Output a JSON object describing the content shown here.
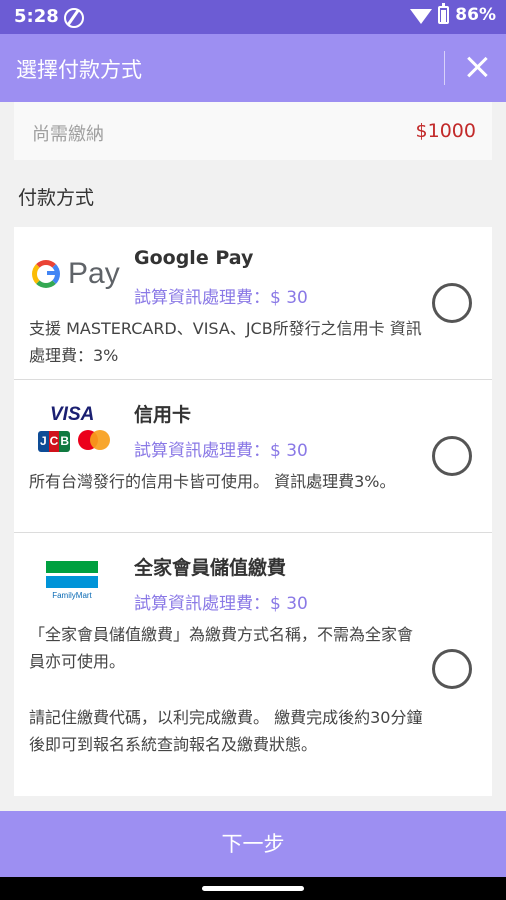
{
  "status_bar": {
    "time": "5:28",
    "battery": "86%"
  },
  "header": {
    "title": "選擇付款方式"
  },
  "amount_due": {
    "label": "尚需繳納",
    "value": "$1000"
  },
  "payment_section": {
    "title": "付款方式",
    "methods": [
      {
        "name": "Google Pay",
        "fee": "試算資訊處理費：$ 30",
        "description": "支援 MASTERCARD、VISA、JCB所發行之信用卡 資訊處理費：3%",
        "logo_text": "Pay"
      },
      {
        "name": "信用卡",
        "fee": "試算資訊處理費：$ 30",
        "description": "所有台灣發行的信用卡皆可使用。 資訊處理費3%。",
        "logo_text": "VISA"
      },
      {
        "name": "全家會員儲值繳費",
        "fee": "試算資訊處理費：$ 30",
        "description": "「全家會員儲值繳費」為繳費方式名稱，不需為全家會員亦可使用。",
        "note": "請記住繳費代碼，以利完成繳費。 繳費完成後約30分鐘後即可到報名系統查詢報名及繳費狀態。",
        "logo_text": "FamilyMart"
      }
    ]
  },
  "footer": {
    "next_label": "下一步"
  },
  "colors": {
    "primary": "#9d8ff2",
    "status_bar": "#6c5cd4",
    "accent_text": "#8a79e6",
    "amount": "#c22a2a"
  }
}
